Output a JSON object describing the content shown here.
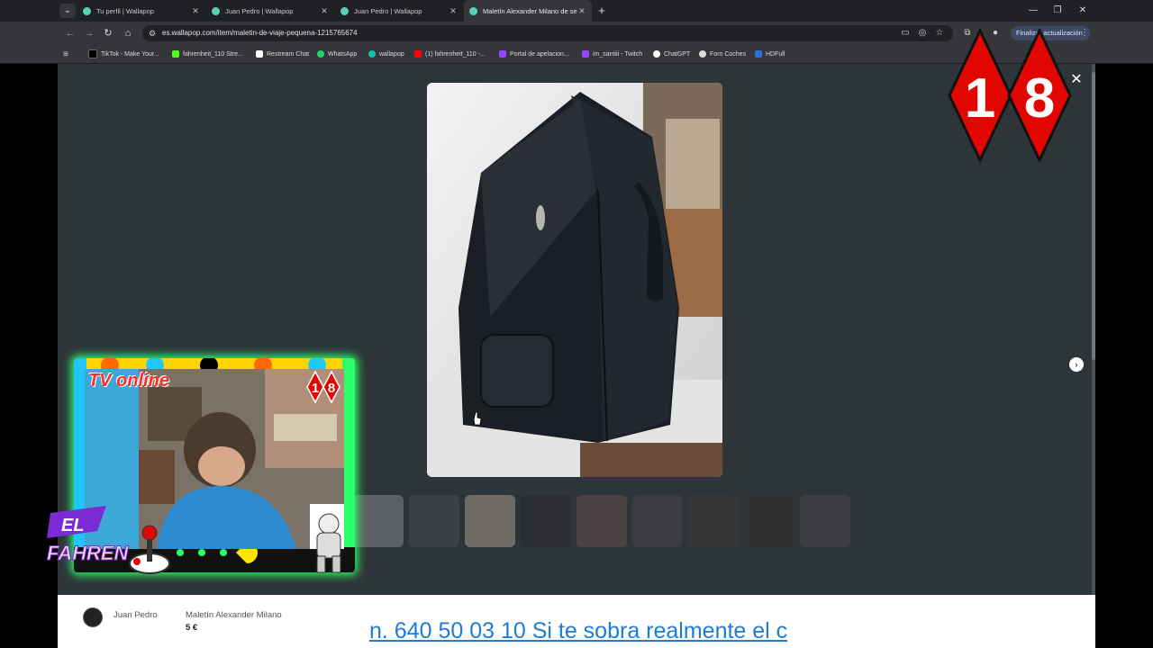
{
  "tabs": [
    {
      "title": "Tu perfil | Wallapop",
      "active": false
    },
    {
      "title": "Juan Pedro | Wallapop",
      "active": false
    },
    {
      "title": "Juan Pedro | Wallapop",
      "active": false
    },
    {
      "title": "Maletín Alexander Milano de se",
      "active": true
    }
  ],
  "address": {
    "url": "es.wallapop.com/item/maletin-de-viaje-pequena-1215765674"
  },
  "update_button": "Finalizar actualización",
  "bookmarks": [
    {
      "label": "TikTok - Make Your...",
      "color": "#000000"
    },
    {
      "label": "fahrenheit_110 Stre...",
      "color": "#53fc18"
    },
    {
      "label": "Restream Chat",
      "color": "#ffffff"
    },
    {
      "label": "WhatsApp",
      "color": "#25d366"
    },
    {
      "label": "wallapop",
      "color": "#13c1ac"
    },
    {
      "label": "(1) fahrenheit_110 -...",
      "color": "#ff0000"
    },
    {
      "label": "Portal de apelacion...",
      "color": "#9146ff"
    },
    {
      "label": "im_santiii - Twitch",
      "color": "#9146ff"
    },
    {
      "label": "ChatGPT",
      "color": "#ffffff"
    },
    {
      "label": "Foro Coches",
      "color": "#dddddd"
    },
    {
      "label": "HDFull",
      "color": "#2a6fdb"
    }
  ],
  "listing": {
    "seller": "Juan Pedro",
    "title": "Maletín Alexander Milano",
    "price": "5 €"
  },
  "ticker": "n. 640 50 03 10 Si te sobra realmente el c",
  "logo_18": {
    "digit1": "1",
    "digit2": "8"
  },
  "overlay": {
    "tv_label": "TV online",
    "badge_1": "1",
    "badge_2": "8",
    "brand_line1": "EL",
    "brand_line2": "FAHREN"
  },
  "colors": {
    "accent_red": "#e10600",
    "wallapop_teal": "#13c1ac",
    "glow_green": "#2cff6a",
    "link_blue": "#1e7bd6"
  }
}
